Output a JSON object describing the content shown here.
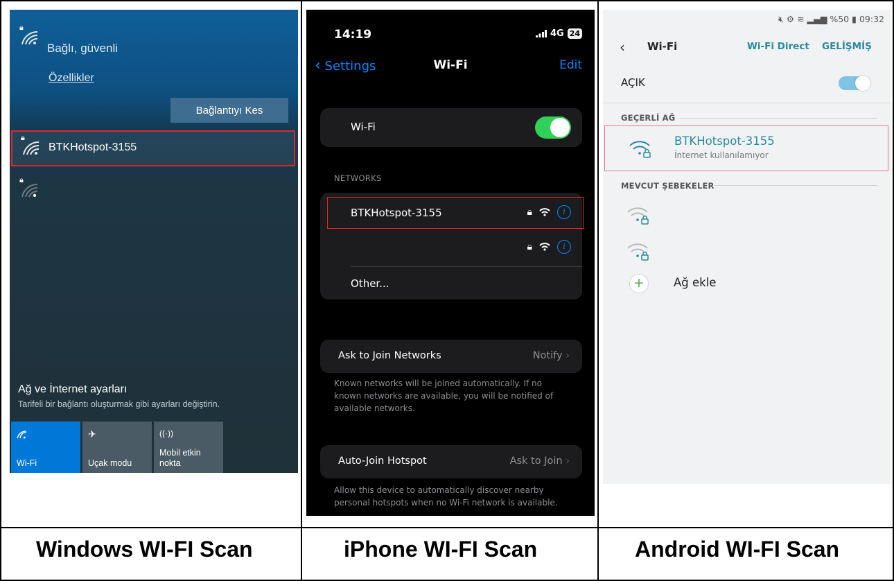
{
  "windows": {
    "connected_status": "Bağlı, güvenli",
    "properties_link": "Özellikler",
    "disconnect_button": "Bağlantıyı Kes",
    "selected_network": "BTKHotspot-3155",
    "settings_title": "Ağ ve İnternet ayarları",
    "settings_subtitle": "Tarifeli bir bağlantı oluşturmak gibi ayarları değiştirin.",
    "tiles": [
      {
        "label": "Wi-Fi",
        "icon": "wifi-icon",
        "active": true
      },
      {
        "label": "Uçak modu",
        "icon": "airplane-icon",
        "active": false
      },
      {
        "label": "Mobil etkin nokta",
        "icon": "hotspot-icon",
        "active": false
      }
    ],
    "colors": {
      "accent": "#0078d7",
      "tile": "#4b5b66",
      "highlight": "#d9292f"
    }
  },
  "iphone": {
    "time": "14:19",
    "network_type": "4G",
    "battery": "24",
    "back_label": "Settings",
    "title": "Wi-Fi",
    "edit_label": "Edit",
    "wifi_label": "Wi-Fi",
    "wifi_on": true,
    "networks_header": "NETWORKS",
    "networks": [
      {
        "name": "BTKHotspot-3155",
        "locked": true
      },
      {
        "name": "",
        "locked": true
      }
    ],
    "other_label": "Other...",
    "ask_label": "Ask to Join Networks",
    "ask_value": "Notify",
    "ask_note": "Known networks will be joined automatically. If no known networks are available, you will be notified of available networks.",
    "auto_label": "Auto-Join Hotspot",
    "auto_value": "Ask to Join",
    "auto_note": "Allow this device to automatically discover nearby personal hotspots when no Wi-Fi network is available.",
    "colors": {
      "accent": "#0a84ff",
      "toggle": "#30d158"
    }
  },
  "android": {
    "status_text": "%50",
    "status_time": "09:32",
    "title": "Wi-Fi",
    "wifi_direct": "Wi-Fi Direct",
    "advanced": "GELİŞMİŞ",
    "on_label": "AÇIK",
    "current_header": "GEÇERLİ AĞ",
    "current_network": "BTKHotspot-3155",
    "current_status": "İnternet kullanılamıyor",
    "available_header": "MEVCUT ŞEBEKELER",
    "add_network": "Ağ ekle",
    "colors": {
      "accent": "#2a8a9b",
      "highlight": "#e47b7b"
    }
  },
  "captions": {
    "windows": "Windows WI-FI Scan",
    "iphone": "iPhone WI-FI Scan",
    "android": "Android WI-FI Scan"
  }
}
